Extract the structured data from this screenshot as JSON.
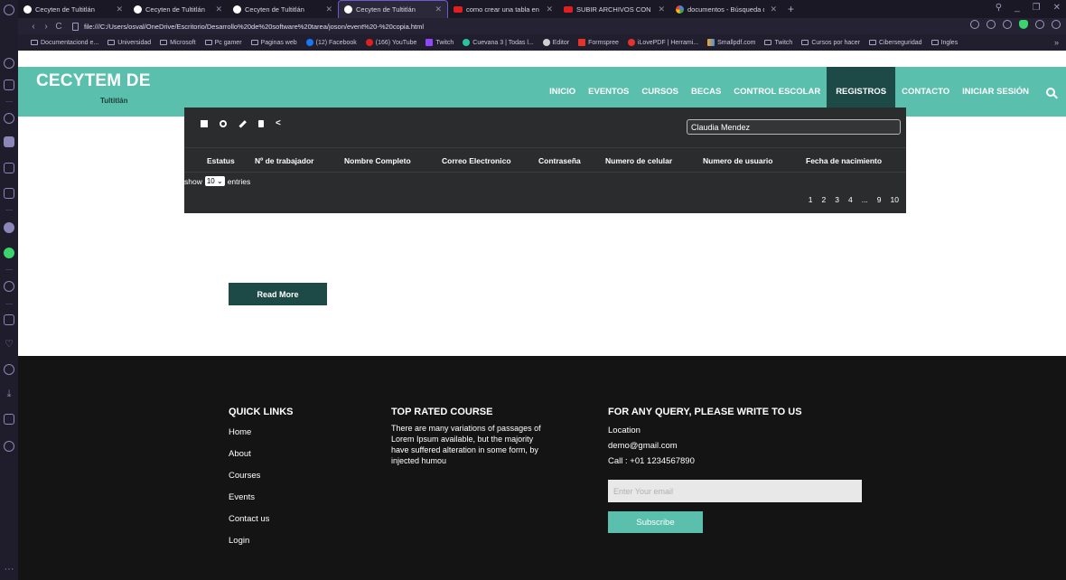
{
  "browser": {
    "tabs": [
      {
        "title": "Cecyten de Tultitlán",
        "icon": "site-icon",
        "active": false
      },
      {
        "title": "Cecyten de Tultitlán",
        "icon": "site-icon",
        "active": false
      },
      {
        "title": "Cecyten de Tultitlán",
        "icon": "site-icon",
        "active": false
      },
      {
        "title": "Cecyten de Tultitlán",
        "icon": "site-icon",
        "active": true
      },
      {
        "title": "como crear una tabla en ht",
        "icon": "youtube-icon",
        "active": false
      },
      {
        "title": "SUBIR ARCHIVOS CON DRA",
        "icon": "youtube-icon",
        "active": false
      },
      {
        "title": "documentos - Búsqueda de",
        "icon": "google-icon",
        "active": false
      }
    ],
    "url": "file:///C:/Users/osval/OneDrive/Escritorio/Desarrollo%20de%20software%20tarea/joson/event%20-%20copia.html",
    "bookmarks": [
      "Documentaciond e...",
      "Universidad",
      "Microsoft",
      "Pc gamer",
      "Paginas web",
      "(12) Facebook",
      "(166) YouTube",
      "Twitch",
      "Cuevana 3 | Todas l...",
      "Editor",
      "Formspree",
      "iLovePDF | Herrami...",
      "Smallpdf.com",
      "Twitch",
      "Cursos por hacer",
      "Ciberseguridad",
      "Ingles"
    ]
  },
  "site": {
    "logo": "CECYTEM DE",
    "logo_sub": "Tultitlán",
    "nav": [
      "INICIO",
      "EVENTOS",
      "CURSOS",
      "BECAS",
      "CONTROL ESCOLAR",
      "REGISTROS",
      "CONTACTO",
      "INICIAR SESIÓN"
    ],
    "nav_active": "REGISTROS",
    "accent": "#5bbfad",
    "dark_accent": "#1d4a47"
  },
  "table": {
    "search_value": "Claudia Mendez",
    "columns": [
      "Estatus",
      "Nº de trabajador",
      "Nombre Completo",
      "Correo Electronico",
      "Contraseña",
      "Numero de celular",
      "Numero de usuario",
      "Fecha de nacimiento"
    ],
    "show_label": "show",
    "page_size": "10",
    "entries_label": "entries",
    "pages": [
      "1",
      "2",
      "3",
      "4",
      "...",
      "9",
      "10"
    ]
  },
  "read_more": "Read More",
  "footer": {
    "quick_links_title": "QUICK LINKS",
    "quick_links": [
      "Home",
      "About",
      "Courses",
      "Events",
      "Contact us",
      "Login"
    ],
    "course_title": "TOP RATED COURSE",
    "course_text": "There are many variations of passages of Lorem Ipsum available, but the majority have suffered alteration in some form, by injected humou",
    "query_title": "FOR ANY QUERY, PLEASE WRITE TO US",
    "location": "Location",
    "email": "demo@gmail.com",
    "call": "Call : +01 1234567890",
    "email_placeholder": "Enter Your email",
    "subscribe": "Subscribe"
  }
}
